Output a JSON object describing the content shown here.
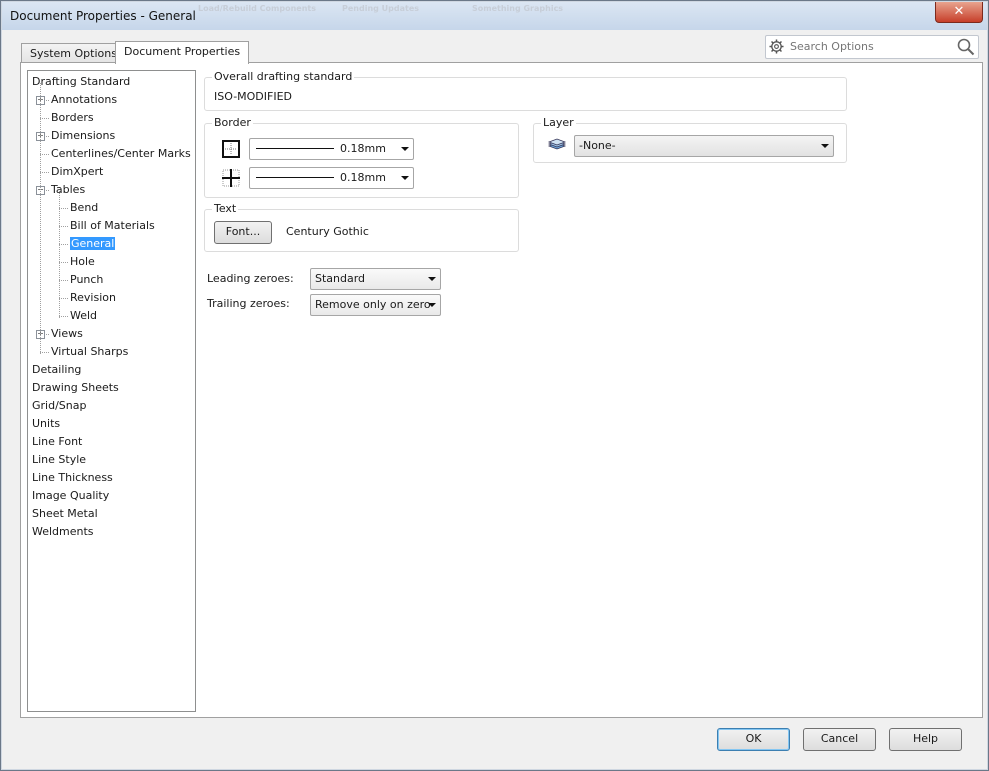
{
  "window": {
    "title": "Document Properties - General",
    "close_glyph": "✕"
  },
  "background_ghosts": [
    "Load/Rebuild Components",
    "Pending Updates",
    "Something Graphics"
  ],
  "tabs": [
    {
      "label": "System Options",
      "active": false
    },
    {
      "label": "Document Properties",
      "active": true
    }
  ],
  "search": {
    "placeholder": "Search Options",
    "icon": "gear-icon"
  },
  "tree": [
    {
      "label": "Drafting Standard",
      "level": 0
    },
    {
      "label": "Annotations",
      "level": 1,
      "expander": "+"
    },
    {
      "label": "Borders",
      "level": 1
    },
    {
      "label": "Dimensions",
      "level": 1,
      "expander": "+"
    },
    {
      "label": "Centerlines/Center Marks",
      "level": 1
    },
    {
      "label": "DimXpert",
      "level": 1
    },
    {
      "label": "Tables",
      "level": 1,
      "expander": "−"
    },
    {
      "label": "Bend",
      "level": 2
    },
    {
      "label": "Bill of Materials",
      "level": 2
    },
    {
      "label": "General",
      "level": 2,
      "selected": true
    },
    {
      "label": "Hole",
      "level": 2
    },
    {
      "label": "Punch",
      "level": 2
    },
    {
      "label": "Revision",
      "level": 2
    },
    {
      "label": "Weld",
      "level": 2
    },
    {
      "label": "Views",
      "level": 1,
      "expander": "+"
    },
    {
      "label": "Virtual Sharps",
      "level": 1
    },
    {
      "label": "Detailing",
      "level": 0
    },
    {
      "label": "Drawing Sheets",
      "level": 0
    },
    {
      "label": "Grid/Snap",
      "level": 0
    },
    {
      "label": "Units",
      "level": 0
    },
    {
      "label": "Line Font",
      "level": 0
    },
    {
      "label": "Line Style",
      "level": 0
    },
    {
      "label": "Line Thickness",
      "level": 0
    },
    {
      "label": "Image Quality",
      "level": 0
    },
    {
      "label": "Sheet Metal",
      "level": 0
    },
    {
      "label": "Weldments",
      "level": 0
    }
  ],
  "overall": {
    "title": "Overall drafting standard",
    "value": "ISO-MODIFIED"
  },
  "border": {
    "title": "Border",
    "outer_value": "0.18mm",
    "inner_value": "0.18mm"
  },
  "layer": {
    "title": "Layer",
    "value": "-None-"
  },
  "text": {
    "title": "Text",
    "font_button": "Font...",
    "font_name": "Century Gothic"
  },
  "zeroes": {
    "leading_label": "Leading zeroes:",
    "leading_value": "Standard",
    "trailing_label": "Trailing zeroes:",
    "trailing_value": "Remove only on zero"
  },
  "footer": {
    "ok": "OK",
    "cancel": "Cancel",
    "help": "Help"
  }
}
